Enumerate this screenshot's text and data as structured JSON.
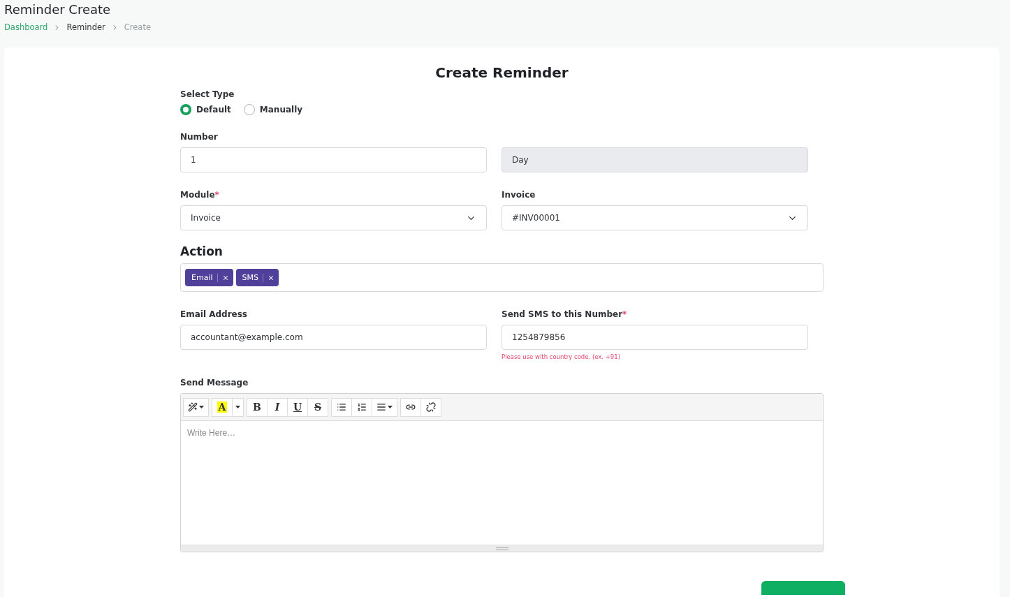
{
  "page": {
    "title": "Reminder Create",
    "breadcrumb": [
      {
        "label": "Dashboard",
        "kind": "link"
      },
      {
        "label": "Reminder",
        "kind": "plain"
      },
      {
        "label": "Create",
        "kind": "current"
      }
    ]
  },
  "form": {
    "title": "Create Reminder",
    "select_type": {
      "label": "Select Type",
      "options": [
        {
          "label": "Default",
          "selected": true
        },
        {
          "label": "Manually",
          "selected": false
        }
      ]
    },
    "number": {
      "label": "Number",
      "value": "1",
      "unit": "Day"
    },
    "module": {
      "label": "Module",
      "required_mark": "*",
      "value": "Invoice"
    },
    "invoice": {
      "label": "Invoice",
      "value": "#INV00001"
    },
    "action": {
      "label": "Action",
      "tags": [
        "Email",
        "SMS"
      ]
    },
    "email": {
      "label": "Email Address",
      "value": "accountant@example.com"
    },
    "sms": {
      "label": "Send SMS to this Number",
      "required_mark": "*",
      "value": "1254879856",
      "hint": "Please use with country code. (ex. +91)"
    },
    "message": {
      "label": "Send Message",
      "placeholder": "Write Here…",
      "toolbar": [
        [
          {
            "kind": "magic"
          }
        ],
        [
          {
            "kind": "color",
            "label": "A"
          },
          {
            "kind": "caret"
          }
        ],
        [
          {
            "kind": "bold",
            "label": "B"
          },
          {
            "kind": "italic",
            "label": "I"
          },
          {
            "kind": "underline",
            "label": "U"
          },
          {
            "kind": "strike",
            "label": "S"
          }
        ],
        [
          {
            "kind": "ul"
          },
          {
            "kind": "ol"
          },
          {
            "kind": "align"
          }
        ],
        [
          {
            "kind": "link"
          },
          {
            "kind": "unlink"
          }
        ]
      ]
    }
  }
}
